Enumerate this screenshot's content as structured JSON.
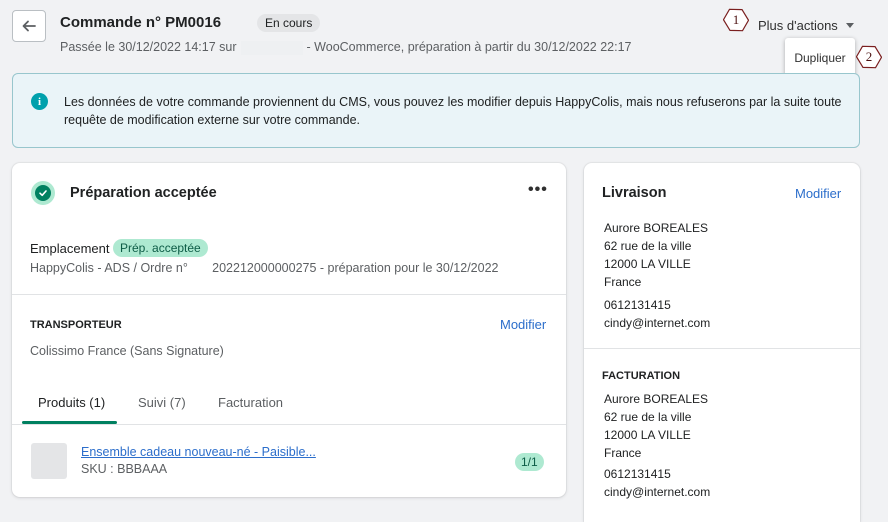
{
  "header": {
    "title": "Commande n° PM0016",
    "status": "En cours",
    "subtitle_before": "Passée le 30/12/2022 14:17 sur",
    "subtitle_after": "- WooCommerce, préparation à partir du 30/12/2022 22:17",
    "more_actions_label": "Plus d'actions",
    "dropdown_item": "Dupliquer"
  },
  "markers": [
    "1",
    "2"
  ],
  "info_banner": {
    "text": "Les données de votre commande proviennent du CMS, vous pouvez les modifier depuis HappyColis, mais nous refuserons par la suite toute requête de modification externe sur votre commande."
  },
  "preparation": {
    "title": "Préparation acceptée",
    "location_label": "Emplacement",
    "location_badge": "Prép. acceptée",
    "location_detail": "HappyColis - ADS / Ordre n°       202212000000275 - préparation pour le 30/12/2022",
    "carrier_heading": "TRANSPORTEUR",
    "carrier_edit": "Modifier",
    "carrier_name": "Colissimo France (Sans Signature)",
    "tabs": [
      "Produits (1)",
      "Suivi (7)",
      "Facturation"
    ],
    "product": {
      "name": "Ensemble cadeau nouveau-né - Paisible...",
      "sku": "SKU : BBBAAA",
      "qty": "1/1"
    }
  },
  "delivery": {
    "title": "Livraison",
    "edit": "Modifier",
    "name": "Aurore BOREALES",
    "street": "62 rue de la ville",
    "city": "12000 LA VILLE",
    "country": "France",
    "phone": "0612131415",
    "email": "cindy@internet.com"
  },
  "billing": {
    "heading": "FACTURATION",
    "name": "Aurore BOREALES",
    "street": "62 rue de la ville",
    "city": "12000 LA VILLE",
    "country": "France",
    "phone": "0612131415",
    "email": "cindy@internet.com"
  }
}
